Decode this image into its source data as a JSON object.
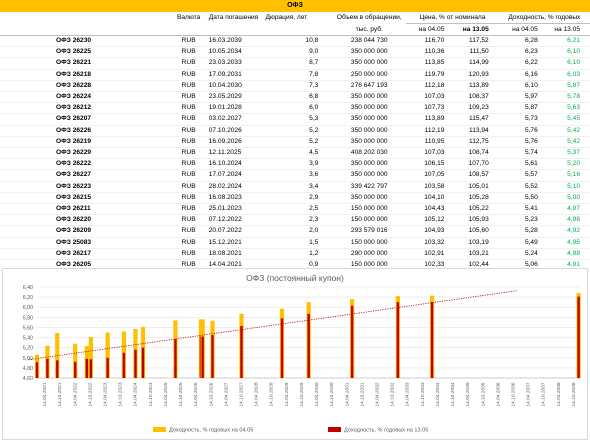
{
  "table": {
    "title": "ОФЗ",
    "headers": {
      "currency": "Валюта",
      "maturity": "Дата погашения",
      "duration": "Дюрация, лет",
      "volume_line1": "Объем в обращении,",
      "volume_line2": "тыс. руб.",
      "price": "Цена, % от номинала",
      "price_d1": "на 04.05",
      "price_d2": "на 13.05",
      "yield": "Доходность, % годовых",
      "yield_d1": "на 04.05",
      "yield_d2": "на 13.05"
    },
    "rows": [
      {
        "name": "ОФЗ 26230",
        "cur": "RUB",
        "date": "16.03.2039",
        "dur": "10,8",
        "vol": "238 044 730",
        "p1": "116,70",
        "p2": "117,52",
        "y1": "6,28",
        "y2": "6,21"
      },
      {
        "name": "ОФЗ 26225",
        "cur": "RUB",
        "date": "10.05.2034",
        "dur": "9,0",
        "vol": "350 000 000",
        "p1": "110,36",
        "p2": "111,50",
        "y1": "6,23",
        "y2": "6,10"
      },
      {
        "name": "ОФЗ 26221",
        "cur": "RUB",
        "date": "23.03.2033",
        "dur": "8,7",
        "vol": "350 000 000",
        "p1": "113,85",
        "p2": "114,99",
        "y1": "6,22",
        "y2": "6,10"
      },
      {
        "name": "ОФЗ 26218",
        "cur": "RUB",
        "date": "17.09.2031",
        "dur": "7,8",
        "vol": "250 000 000",
        "p1": "119,79",
        "p2": "120,93",
        "y1": "6,16",
        "y2": "6,03"
      },
      {
        "name": "ОФЗ 26228",
        "cur": "RUB",
        "date": "10.04.2030",
        "dur": "7,3",
        "vol": "276 647 193",
        "p1": "112,18",
        "p2": "113,89",
        "y1": "6,10",
        "y2": "5,87"
      },
      {
        "name": "ОФЗ 26224",
        "cur": "RUB",
        "date": "23.05.2029",
        "dur": "6,8",
        "vol": "350 000 000",
        "p1": "107,03",
        "p2": "108,37",
        "y1": "5,97",
        "y2": "5,78"
      },
      {
        "name": "ОФЗ 26212",
        "cur": "RUB",
        "date": "19.01.2028",
        "dog": "",
        "dur": "6,0",
        "vol": "350 000 000",
        "p1": "107,73",
        "p2": "109,23",
        "y1": "5,87",
        "y2": "5,63"
      },
      {
        "name": "ОФЗ 26207",
        "cur": "RUB",
        "date": "03.02.2027",
        "dur": "5,3",
        "vol": "350 000 000",
        "p1": "113,89",
        "p2": "115,47",
        "y1": "5,73",
        "y2": "5,45"
      },
      {
        "name": "ОФЗ 26226",
        "cur": "RUB",
        "date": "07.10.2026",
        "dur": "5,2",
        "vol": "350 000 000",
        "p1": "112,19",
        "p2": "113,94",
        "y1": "5,76",
        "y2": "5,42"
      },
      {
        "name": "ОФЗ 26219",
        "cur": "RUB",
        "date": "16.09.2026",
        "dur": "5,2",
        "vol": "350 000 000",
        "p1": "110,95",
        "p2": "112,75",
        "y1": "5,76",
        "y2": "5,42"
      },
      {
        "name": "ОФЗ 26229",
        "cur": "RUB",
        "date": "12.11.2025",
        "dur": "4,5",
        "vol": "408 202 030",
        "p1": "107,03",
        "p2": "108,74",
        "y1": "5,74",
        "y2": "5,37"
      },
      {
        "name": "ОФЗ 26222",
        "cur": "RUB",
        "date": "16.10.2024",
        "dur": "3,9",
        "vol": "350 000 000",
        "p1": "106,15",
        "p2": "107,70",
        "y1": "5,61",
        "y2": "5,20"
      },
      {
        "name": "ОФЗ 26227",
        "cur": "RUB",
        "date": "17.07.2024",
        "dur": "3,6",
        "vol": "350 000 000",
        "p1": "107,05",
        "p2": "108,57",
        "y1": "5,57",
        "y2": "5,16"
      },
      {
        "name": "ОФЗ 26223",
        "cur": "RUB",
        "date": "28.02.2024",
        "dur": "3,4",
        "vol": "339 422 797",
        "p1": "103,58",
        "p2": "105,01",
        "y1": "5,52",
        "y2": "5,10"
      },
      {
        "name": "ОФЗ 26215",
        "cur": "RUB",
        "date": "16.08.2023",
        "dur": "2,9",
        "vol": "350 000 000",
        "p1": "104,10",
        "p2": "105,28",
        "y1": "5,50",
        "y2": "5,00"
      },
      {
        "name": "ОФЗ 26211",
        "cur": "RUB",
        "date": "25.01.2023",
        "dur": "2,5",
        "vol": "150 000 000",
        "p1": "104,43",
        "p2": "105,22",
        "y1": "5,41",
        "y2": "4,97"
      },
      {
        "name": "ОФЗ 26220",
        "cur": "RUB",
        "date": "07.12.2022",
        "dur": "2,3",
        "vol": "150 000 000",
        "p1": "105,12",
        "p2": "105,93",
        "y1": "5,23",
        "y2": "4,98"
      },
      {
        "name": "ОФЗ 26209",
        "cur": "RUB",
        "date": "20.07.2022",
        "dur": "2,0",
        "vol": "293 579 016",
        "p1": "104,93",
        "p2": "105,60",
        "y1": "5,28",
        "y2": "4,92"
      },
      {
        "name": "ОФЗ 25083",
        "cur": "RUB",
        "date": "15.12.2021",
        "dur": "1,5",
        "vol": "150 000 000",
        "p1": "103,32",
        "p2": "103,19",
        "y1": "5,49",
        "y2": "4,95"
      },
      {
        "name": "ОФЗ 26217",
        "cur": "RUB",
        "date": "18.08.2021",
        "dur": "1,2",
        "vol": "290 000 000",
        "p1": "102,91",
        "p2": "103,21",
        "y1": "5,24",
        "y2": "4,98"
      },
      {
        "name": "ОФЗ 26205",
        "cur": "RUB",
        "date": "14.04.2021",
        "dur": "0,9",
        "vol": "150 000 000",
        "p1": "102,33",
        "p2": "102,44",
        "y1": "5,06",
        "y2": "4,91"
      }
    ]
  },
  "chart_data": {
    "type": "bar",
    "title": "ОФЗ (постоянный купон)",
    "ylim": [
      4.6,
      6.4
    ],
    "yticks": [
      "4,60",
      "4,80",
      "5,00",
      "5,20",
      "5,40",
      "5,60",
      "5,80",
      "6,00",
      "6,20",
      "6,40"
    ],
    "xtick_labels": [
      "14.04.2021",
      "14.10.2021",
      "14.04.2022",
      "14.10.2022",
      "14.04.2023",
      "14.10.2023",
      "14.04.2024",
      "14.10.2024",
      "14.04.2025",
      "14.10.2025",
      "14.04.2026",
      "14.10.2026",
      "14.04.2027",
      "14.10.2027",
      "14.04.2028",
      "14.10.2028",
      "14.04.2029",
      "14.10.2029",
      "14.04.2030",
      "14.10.2030",
      "14.04.2031",
      "14.10.2031",
      "14.04.2032",
      "14.10.2032",
      "14.04.2033",
      "14.10.2033",
      "14.04.2034",
      "14.10.2034",
      "14.04.2035",
      "14.10.2035",
      "14.04.2036",
      "14.10.2036",
      "14.04.2037",
      "14.10.2037",
      "14.04.2038",
      "14.10.2038"
    ],
    "x_start": "2021-04-14",
    "x_end": "2039-04-14",
    "bars": [
      {
        "date": "2021-04-14",
        "y1": 5.06,
        "y2": 4.91
      },
      {
        "date": "2021-08-18",
        "y1": 5.24,
        "y2": 4.98
      },
      {
        "date": "2021-12-15",
        "y1": 5.49,
        "y2": 4.95
      },
      {
        "date": "2022-07-20",
        "y1": 5.28,
        "y2": 4.92
      },
      {
        "date": "2022-12-07",
        "y1": 5.23,
        "y2": 4.98
      },
      {
        "date": "2023-01-25",
        "y1": 5.41,
        "y2": 4.97
      },
      {
        "date": "2023-08-16",
        "y1": 5.5,
        "y2": 5.0
      },
      {
        "date": "2024-02-28",
        "y1": 5.52,
        "y2": 5.1
      },
      {
        "date": "2024-07-17",
        "y1": 5.57,
        "y2": 5.16
      },
      {
        "date": "2024-10-16",
        "y1": 5.61,
        "y2": 5.2
      },
      {
        "date": "2025-11-12",
        "y1": 5.74,
        "y2": 5.37
      },
      {
        "date": "2026-09-16",
        "y1": 5.76,
        "y2": 5.42
      },
      {
        "date": "2026-10-07",
        "y1": 5.76,
        "y2": 5.42
      },
      {
        "date": "2027-02-03",
        "y1": 5.73,
        "y2": 5.45
      },
      {
        "date": "2028-01-19",
        "y1": 5.87,
        "y2": 5.63
      },
      {
        "date": "2029-05-23",
        "y1": 5.97,
        "y2": 5.78
      },
      {
        "date": "2030-04-10",
        "y1": 6.1,
        "y2": 5.87
      },
      {
        "date": "2031-09-17",
        "y1": 6.16,
        "y2": 6.03
      },
      {
        "date": "2033-03-23",
        "y1": 6.22,
        "y2": 6.1
      },
      {
        "date": "2034-05-10",
        "y1": 6.23,
        "y2": 6.1
      },
      {
        "date": "2039-03-16",
        "y1": 6.28,
        "y2": 6.21
      }
    ],
    "trend": {
      "from": [
        2021.0,
        4.96
      ],
      "to": [
        2037.2,
        6.33
      ]
    },
    "series": [
      {
        "name": "Доходность, % годовых на 04.05",
        "color": "#ffc000"
      },
      {
        "name": "Доходность, % годовых на 13.05",
        "color": "#c00000"
      }
    ],
    "trend_color": "#c00000",
    "grid": true,
    "legend": "bottom"
  }
}
